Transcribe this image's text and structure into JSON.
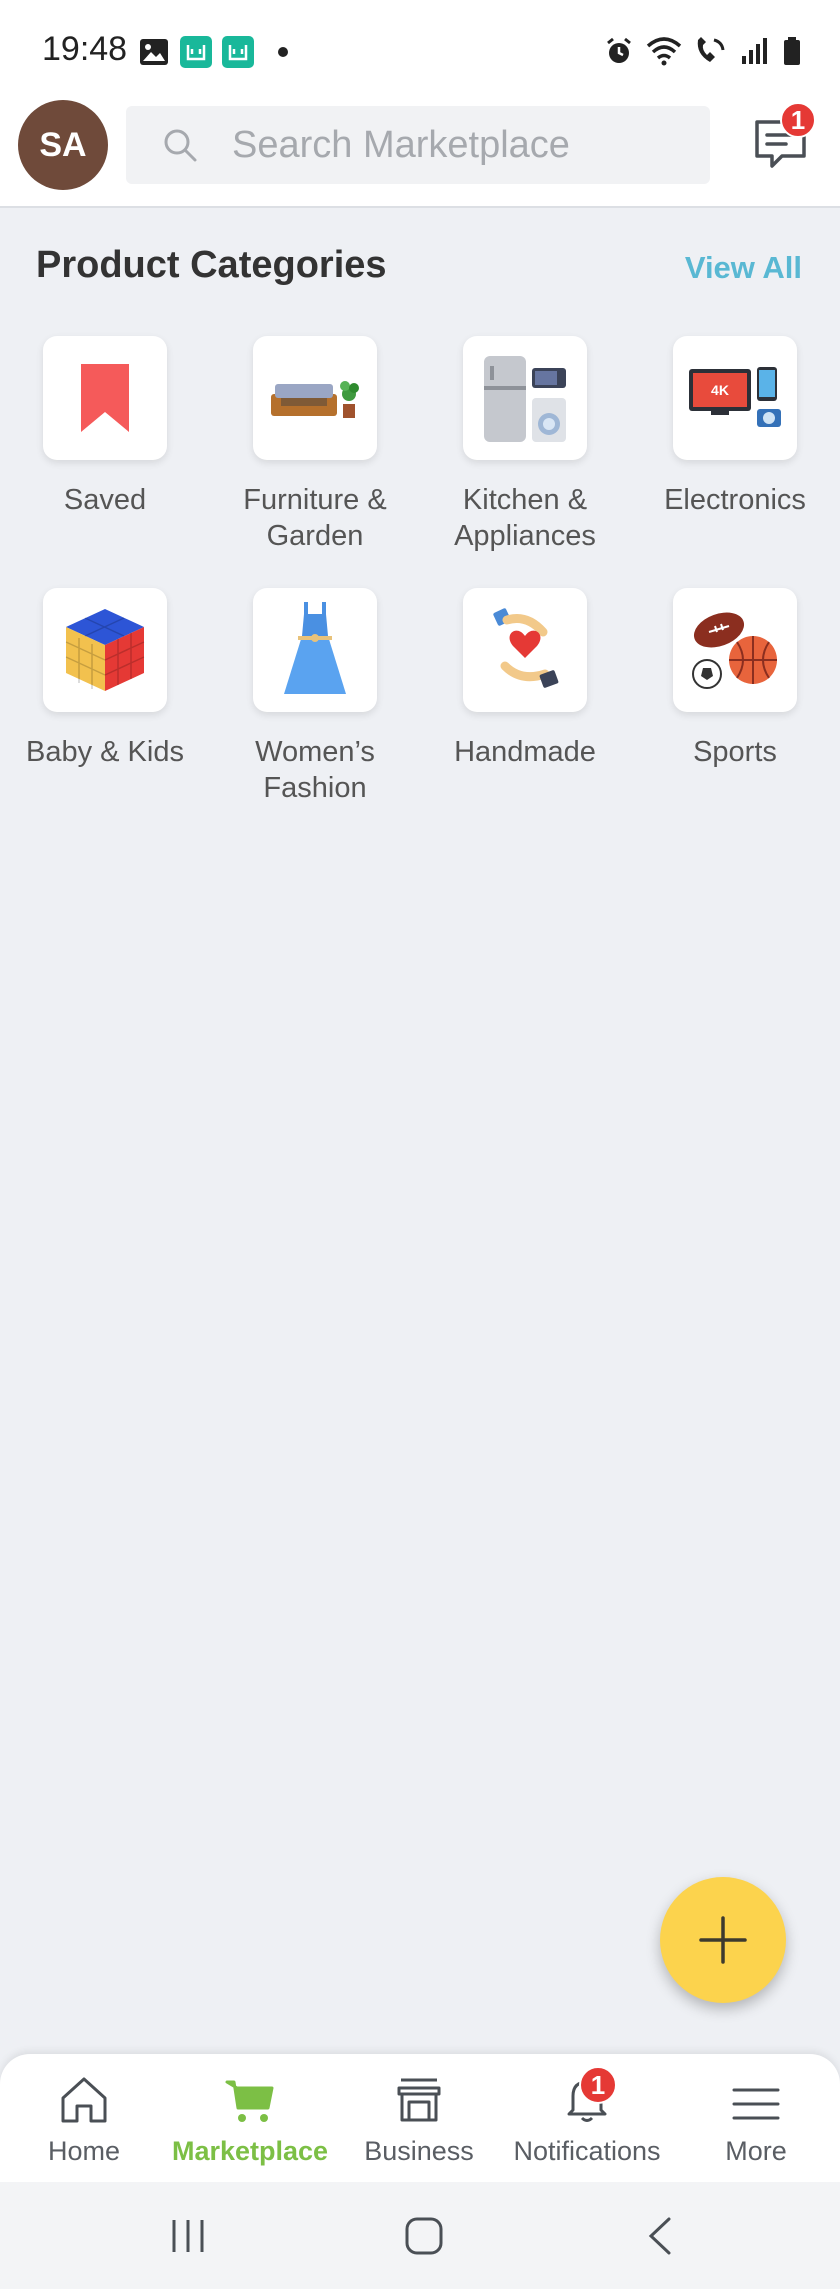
{
  "status_bar": {
    "time": "19:48",
    "left_icons": [
      "image-icon",
      "mi-app-icon",
      "mi-app-icon",
      "dot-icon"
    ],
    "right_icons": [
      "alarm-icon",
      "wifi-icon",
      "wifi-call-icon",
      "signal-icon",
      "battery-icon"
    ]
  },
  "header": {
    "avatar_initials": "SA",
    "avatar_color": "#6f4a3a",
    "search_placeholder": "Search Marketplace",
    "messages_badge": "1"
  },
  "categories_section": {
    "title": "Product Categories",
    "view_all": "View All",
    "items": [
      {
        "label": "Saved",
        "icon": "bookmark-icon"
      },
      {
        "label": "Furniture & Garden",
        "icon": "sofa-plant-icon"
      },
      {
        "label": "Kitchen & Appliances",
        "icon": "fridge-washer-icon"
      },
      {
        "label": "Electronics",
        "icon": "tv-phone-camera-icon"
      },
      {
        "label": "Baby & Kids",
        "icon": "toy-cube-icon"
      },
      {
        "label": "Women’s Fashion",
        "icon": "dress-icon"
      },
      {
        "label": "Handmade",
        "icon": "hands-heart-icon"
      },
      {
        "label": "Sports",
        "icon": "balls-icon"
      }
    ]
  },
  "fab": {
    "icon": "plus-icon",
    "color": "#fcd34d"
  },
  "bottom_nav": {
    "items": [
      {
        "label": "Home",
        "icon": "home-icon"
      },
      {
        "label": "Marketplace",
        "icon": "cart-icon",
        "active": true
      },
      {
        "label": "Business",
        "icon": "storefront-icon"
      },
      {
        "label": "Notifications",
        "icon": "bell-icon",
        "badge": "1"
      },
      {
        "label": "More",
        "icon": "menu-icon"
      }
    ],
    "active_color": "#7cbf45"
  },
  "system_nav": [
    "recents-icon",
    "home-button-icon",
    "back-icon"
  ]
}
